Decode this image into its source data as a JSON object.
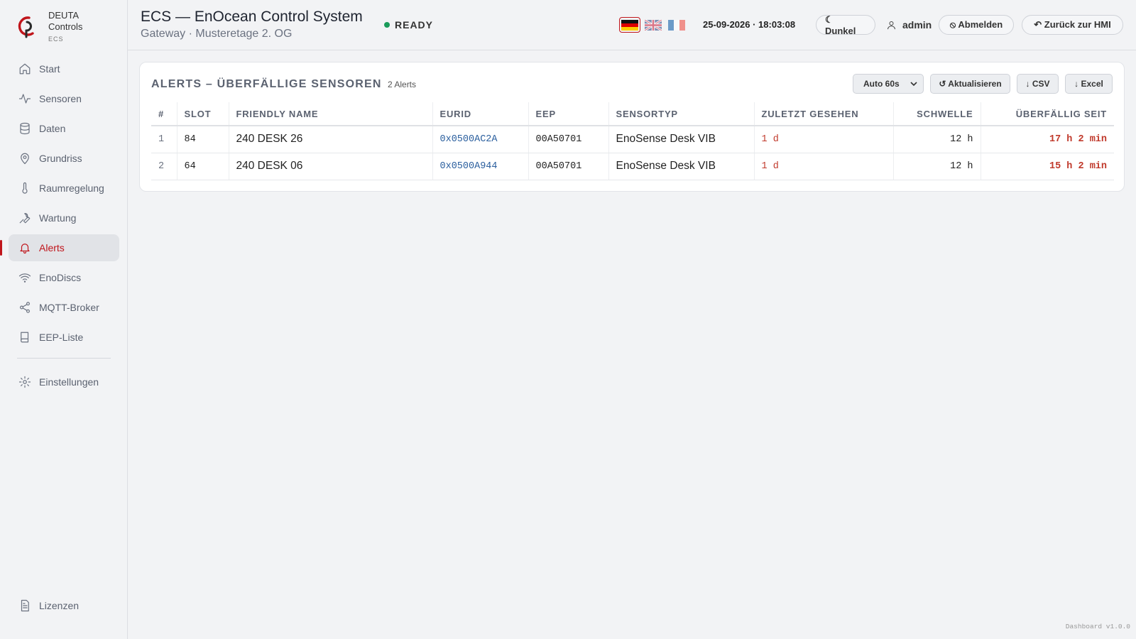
{
  "brand": {
    "name_line1": "DEUTA",
    "name_line2": "Controls",
    "sub": "ECS"
  },
  "sidebar": {
    "items": [
      {
        "label": "Start",
        "icon": "home-icon"
      },
      {
        "label": "Sensoren",
        "icon": "activity-icon"
      },
      {
        "label": "Daten",
        "icon": "database-icon"
      },
      {
        "label": "Grundriss",
        "icon": "map-pin-icon"
      },
      {
        "label": "Raumregelung",
        "icon": "thermometer-icon"
      },
      {
        "label": "Wartung",
        "icon": "wrench-icon"
      },
      {
        "label": "Alerts",
        "icon": "bell-icon",
        "active": true
      },
      {
        "label": "EnoDiscs",
        "icon": "wifi-icon"
      },
      {
        "label": "MQTT-Broker",
        "icon": "share-icon"
      },
      {
        "label": "EEP-Liste",
        "icon": "book-icon"
      }
    ],
    "settings": {
      "label": "Einstellungen",
      "icon": "gear-icon"
    },
    "licenses": {
      "label": "Lizenzen",
      "icon": "file-icon"
    }
  },
  "header": {
    "title": "ECS — EnOcean Control System",
    "subtitle": "Gateway · Musteretage 2. OG",
    "status": "READY",
    "languages": [
      "de",
      "en",
      "fr"
    ],
    "active_language": "de",
    "datetime": "25-09-2026 · 18:03:08",
    "theme_button": "☾ Dunkel",
    "user": "admin",
    "logout_button": "⦸ Abmelden",
    "back_button": "↶ Zurück zur HMI"
  },
  "alerts": {
    "title": "ALERTS – ÜBERFÄLLIGE SENSOREN",
    "count": "2 Alerts",
    "refresh_select": "Auto 60s",
    "refresh_button": "↺ Aktualisieren",
    "csv_button": "↓ CSV",
    "excel_button": "↓ Excel",
    "columns": [
      "#",
      "SLOT",
      "FRIENDLY NAME",
      "EURID",
      "EEP",
      "SENSORTYP",
      "ZULETZT GESEHEN",
      "SCHWELLE",
      "ÜBERFÄLLIG SEIT"
    ],
    "rows": [
      {
        "index": "1",
        "slot": "84",
        "name": "240 DESK 26",
        "eurid": "0x0500AC2A",
        "eep": "00A50701",
        "type": "EnoSense Desk VIB",
        "last_seen": "1 d",
        "threshold": "12 h",
        "overdue": "17 h 2 min"
      },
      {
        "index": "2",
        "slot": "64",
        "name": "240 DESK 06",
        "eurid": "0x0500A944",
        "eep": "00A50701",
        "type": "EnoSense Desk VIB",
        "last_seen": "1 d",
        "threshold": "12 h",
        "overdue": "15 h 2 min"
      }
    ]
  },
  "footer": {
    "version": "Dashboard v1.0.0"
  },
  "colors": {
    "accent": "#c0151b",
    "ready": "#1a9b5a",
    "link": "#2b5f9e",
    "warn": "#c0392b"
  }
}
